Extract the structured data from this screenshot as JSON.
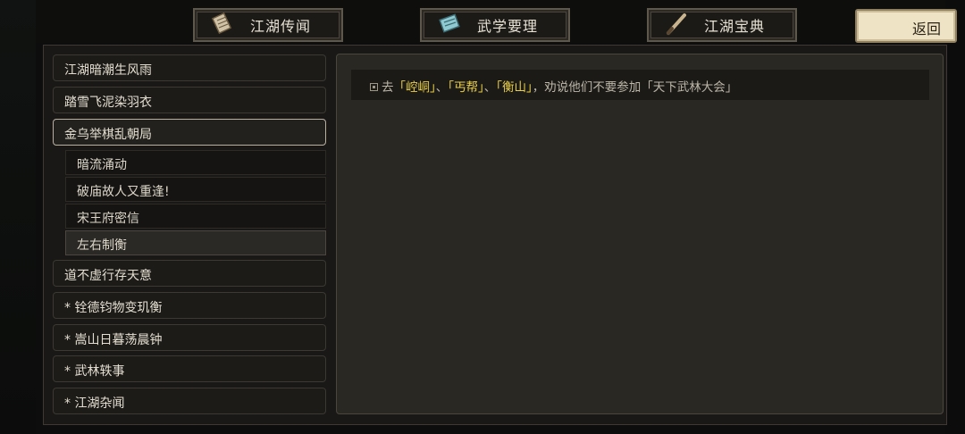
{
  "tabs": [
    {
      "label": "江湖传闻",
      "icon": "scroll-book-icon"
    },
    {
      "label": "武学要理",
      "icon": "martial-manual-icon"
    },
    {
      "label": "江湖宝典",
      "icon": "brush-pen-icon"
    }
  ],
  "back_label": "返回",
  "chapters": [
    {
      "label": "江湖暗潮生风雨"
    },
    {
      "label": "踏雪飞泥染羽衣"
    },
    {
      "label": "金乌举棋乱朝局"
    },
    {
      "label": "道不虚行存天意"
    },
    {
      "label": "* 铨德钧物变玑衡"
    },
    {
      "label": "* 嵩山日暮荡晨钟"
    },
    {
      "label": "* 武林轶事"
    },
    {
      "label": "* 江湖杂闻"
    }
  ],
  "sub_items": [
    {
      "label": "暗流涌动"
    },
    {
      "label": "破庙故人又重逢!"
    },
    {
      "label": "宋王府密信"
    },
    {
      "label": "左右制衡"
    }
  ],
  "quest": {
    "prefix": "去",
    "t1": "「崆峒」",
    "sep1": "、",
    "t2": "「丐帮」",
    "sep2": "、",
    "t3": "「衡山」",
    "suffix": "，劝说他们不要参加「天下武林大会」"
  },
  "colors": {
    "highlight": "#e9cf4a",
    "back_button": "#efe3c5"
  }
}
